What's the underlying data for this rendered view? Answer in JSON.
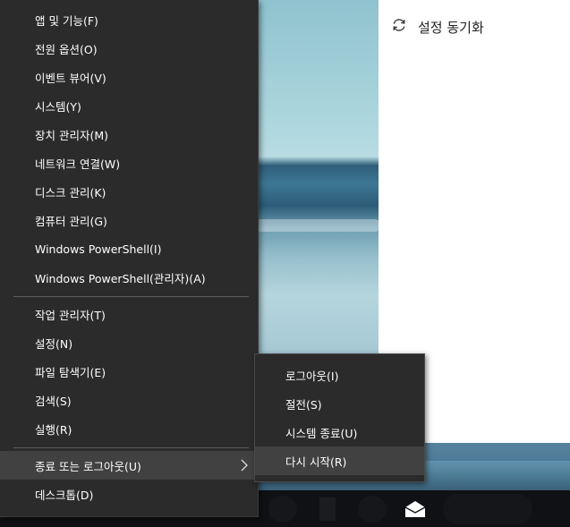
{
  "winx_menu": {
    "group1": [
      {
        "label": "앱 및 기능(F)"
      },
      {
        "label": "전원 옵션(O)"
      },
      {
        "label": "이벤트 뷰어(V)"
      },
      {
        "label": "시스템(Y)"
      },
      {
        "label": "장치 관리자(M)"
      },
      {
        "label": "네트워크 연결(W)"
      },
      {
        "label": "디스크 관리(K)"
      },
      {
        "label": "컴퓨터 관리(G)"
      },
      {
        "label": "Windows PowerShell(I)"
      },
      {
        "label": "Windows PowerShell(관리자)(A)"
      }
    ],
    "group2": [
      {
        "label": "작업 관리자(T)"
      },
      {
        "label": "설정(N)"
      },
      {
        "label": "파일 탐색기(E)"
      },
      {
        "label": "검색(S)"
      },
      {
        "label": "실행(R)"
      }
    ],
    "group3": [
      {
        "label": "종료 또는 로그아웃(U)",
        "has_submenu": true,
        "highlighted": true
      },
      {
        "label": "데스크톱(D)"
      }
    ]
  },
  "submenu": {
    "items": [
      {
        "label": "로그아웃(I)"
      },
      {
        "label": "절전(S)"
      },
      {
        "label": "시스템 종료(U)"
      },
      {
        "label": "다시 시작(R)",
        "highlighted": true
      }
    ]
  },
  "settings_pane": {
    "sync_label": "설정 동기화",
    "sync_icon": "sync-icon"
  },
  "taskbar": {
    "icons": [
      "app-icon",
      "mail-icon"
    ]
  },
  "colors": {
    "menu_bg": "#2b2b2b",
    "menu_hover": "#414141",
    "separator": "#5c5c5c",
    "text": "#ffffff"
  }
}
